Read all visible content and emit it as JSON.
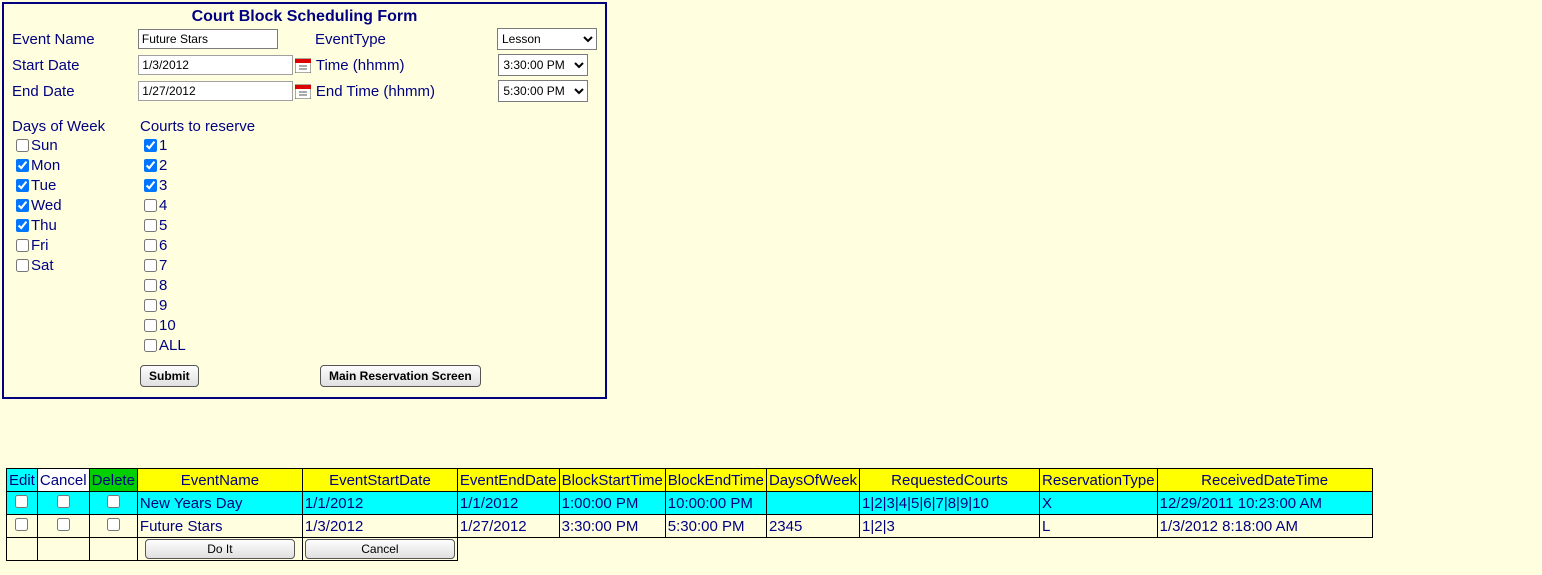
{
  "form": {
    "title": "Court Block Scheduling Form",
    "labels": {
      "eventName": "Event Name",
      "eventType": "EventType",
      "startDate": "Start Date",
      "time": "Time (hhmm)",
      "endDate": "End Date",
      "endTime": "End Time (hhmm)",
      "daysOfWeek": "Days of Week",
      "courts": "Courts to reserve"
    },
    "values": {
      "eventName": "Future Stars",
      "eventType": "Lesson",
      "startDate": "1/3/2012",
      "time": "3:30:00 PM",
      "endDate": "1/27/2012",
      "endTime": "5:30:00 PM"
    },
    "days": [
      {
        "label": "Sun",
        "checked": false
      },
      {
        "label": "Mon",
        "checked": true
      },
      {
        "label": "Tue",
        "checked": true
      },
      {
        "label": "Wed",
        "checked": true
      },
      {
        "label": "Thu",
        "checked": true
      },
      {
        "label": "Fri",
        "checked": false
      },
      {
        "label": "Sat",
        "checked": false
      }
    ],
    "courts": [
      {
        "label": "1",
        "checked": true
      },
      {
        "label": "2",
        "checked": true
      },
      {
        "label": "3",
        "checked": true
      },
      {
        "label": "4",
        "checked": false
      },
      {
        "label": "5",
        "checked": false
      },
      {
        "label": "6",
        "checked": false
      },
      {
        "label": "7",
        "checked": false
      },
      {
        "label": "8",
        "checked": false
      },
      {
        "label": "9",
        "checked": false
      },
      {
        "label": "10",
        "checked": false
      },
      {
        "label": "ALL",
        "checked": false
      }
    ],
    "buttons": {
      "submit": "Submit",
      "main": "Main Reservation Screen"
    }
  },
  "grid": {
    "headers": {
      "edit": "Edit",
      "cancel": "Cancel",
      "delete": "Delete",
      "eventName": "EventName",
      "eventStartDate": "EventStartDate",
      "eventEndDate": "EventEndDate",
      "blockStartTime": "BlockStartTime",
      "blockEndTime": "BlockEndTime",
      "daysOfWeek": "DaysOfWeek",
      "requestedCourts": "RequestedCourts",
      "reservationType": "ReservationType",
      "receivedDateTime": "ReceivedDateTime"
    },
    "rows": [
      {
        "style": "cyan",
        "eventName": "New Years Day",
        "eventStartDate": "1/1/2012",
        "eventEndDate": "1/1/2012",
        "blockStartTime": "1:00:00 PM",
        "blockEndTime": "10:00:00 PM",
        "daysOfWeek": "",
        "requestedCourts": "1|2|3|4|5|6|7|8|9|10",
        "reservationType": "X",
        "receivedDateTime": "12/29/2011 10:23:00 AM"
      },
      {
        "style": "cream",
        "eventName": "Future Stars",
        "eventStartDate": "1/3/2012",
        "eventEndDate": "1/27/2012",
        "blockStartTime": "3:30:00 PM",
        "blockEndTime": "5:30:00 PM",
        "daysOfWeek": "2345",
        "requestedCourts": "1|2|3",
        "reservationType": "L",
        "receivedDateTime": "1/3/2012 8:18:00 AM"
      }
    ],
    "footerButtons": {
      "doit": "Do It",
      "cancel": "Cancel"
    }
  }
}
